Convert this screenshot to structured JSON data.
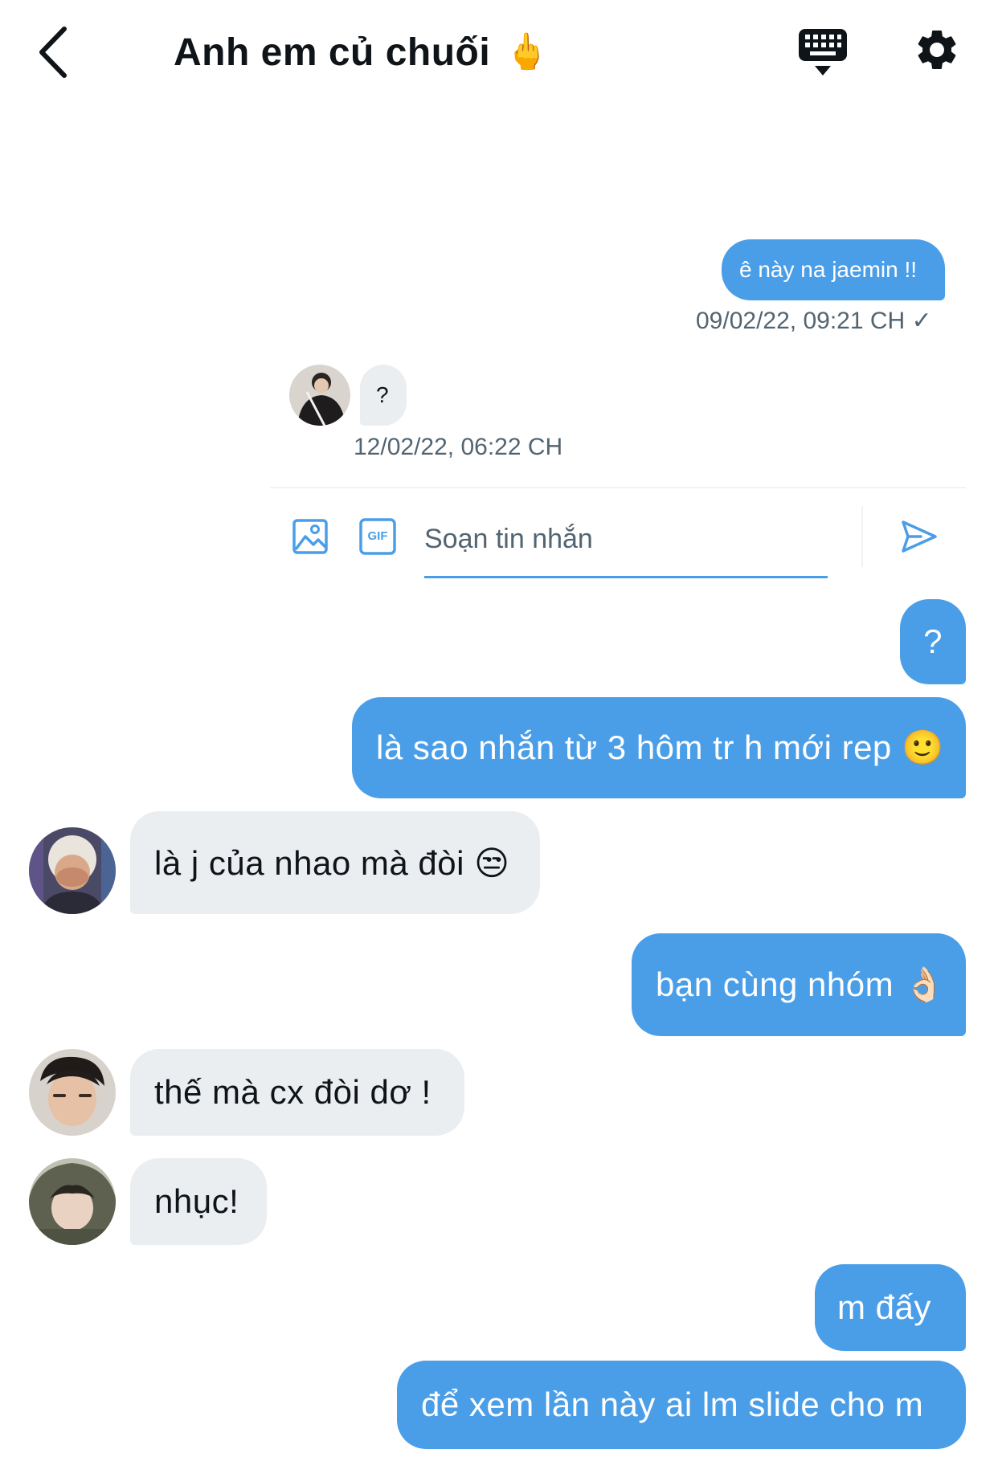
{
  "header": {
    "title": "Anh em củ chuối",
    "title_emoji": "🖕"
  },
  "messages": [
    {
      "text": "ê này na jaemin !!",
      "timestamp": "09/02/22, 09:21 CH ✓"
    },
    {
      "text": "?",
      "timestamp": "12/02/22, 06:22 CH"
    },
    {
      "text": "?"
    },
    {
      "text": "là sao nhắn từ 3 hôm tr h mới rep 🙂"
    },
    {
      "text": "là j của nhao mà đòi 😒"
    },
    {
      "text": "bạn cùng nhóm 👌🏻"
    },
    {
      "text": "thế mà cx đòi dơ !"
    },
    {
      "text": "nhục!"
    },
    {
      "text": "m đấy"
    },
    {
      "text": "để xem lần này ai lm slide cho m"
    }
  ],
  "compose": {
    "placeholder": "Soạn tin nhắn",
    "gif_label": "GIF"
  },
  "colors": {
    "accent": "#4a9ee8",
    "incoming_bubble": "#ebeef0",
    "muted_text": "#536471"
  }
}
